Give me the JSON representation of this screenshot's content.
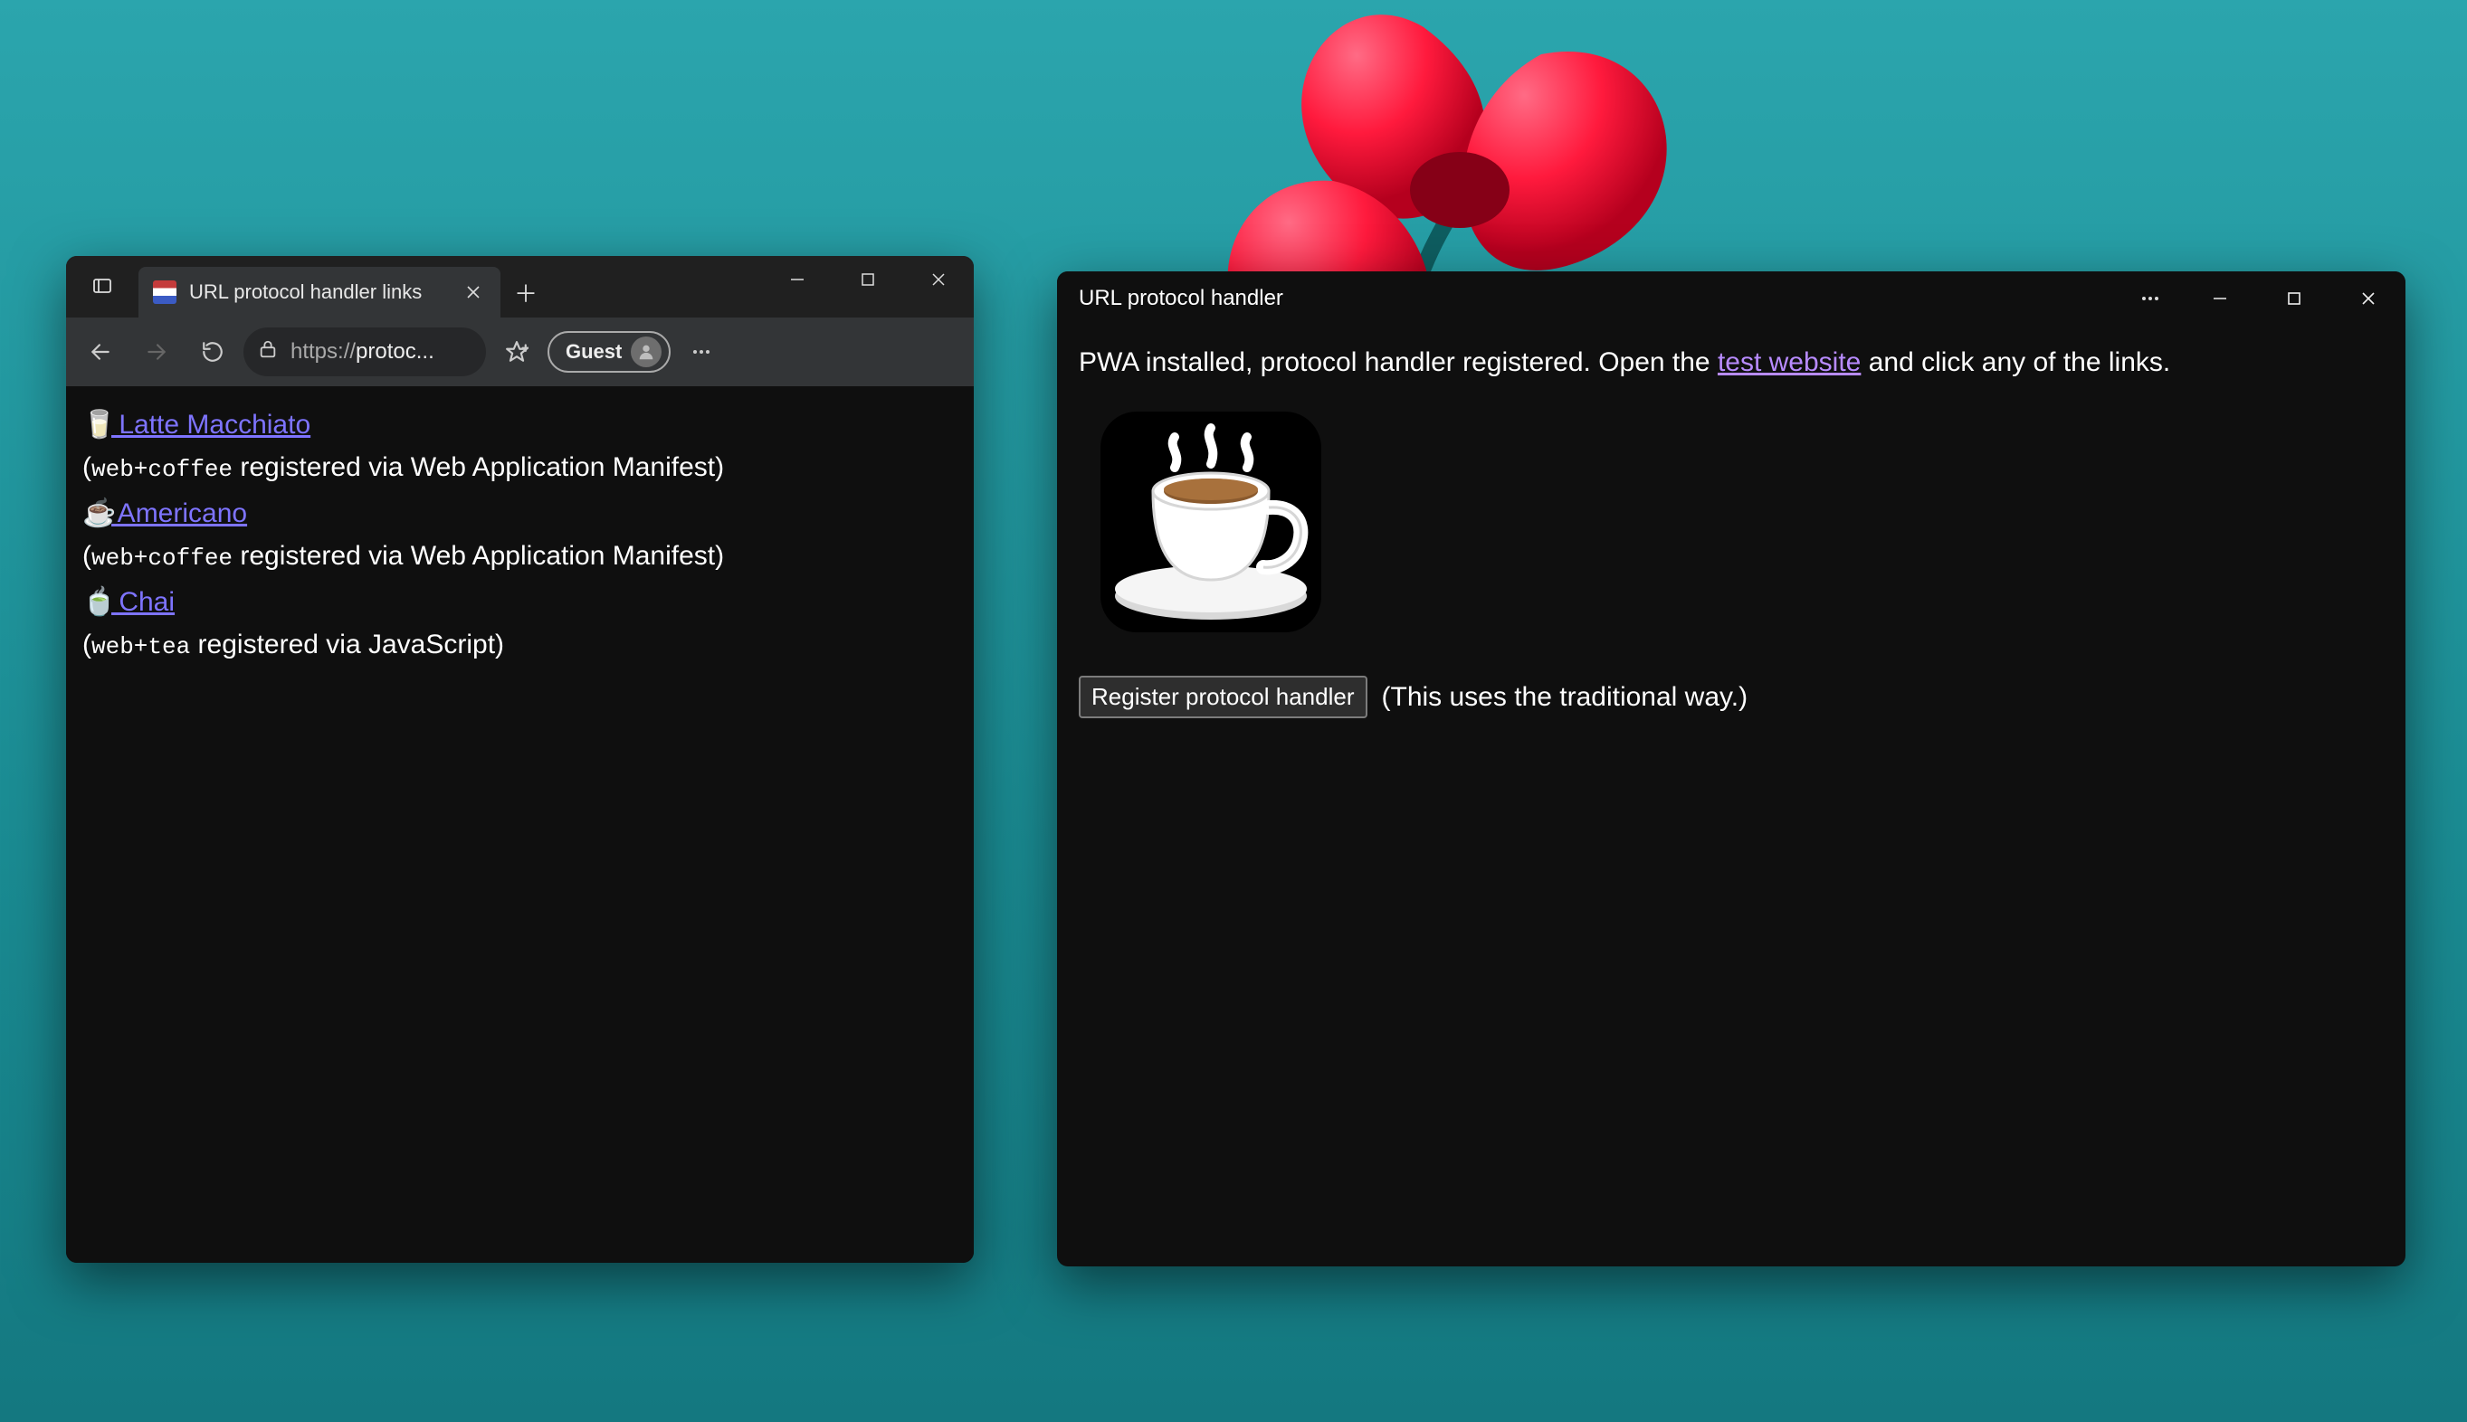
{
  "browser": {
    "tab_title": "URL protocol handler links",
    "url_display_prefix": "https://",
    "url_display_rest": "protoc...",
    "guest_label": "Guest",
    "links": [
      {
        "emoji": "🥛",
        "label": " Latte Macchiato",
        "proto": "web+coffee",
        "note": " registered via Web Application Manifest)"
      },
      {
        "emoji": "☕",
        "label": " Americano",
        "proto": "web+coffee",
        "note": " registered via Web Application Manifest)"
      },
      {
        "emoji": "🍵",
        "label": " Chai",
        "proto": "web+tea",
        "note": " registered via JavaScript)"
      }
    ]
  },
  "pwa": {
    "title": "URL protocol handler",
    "msg_before_link": "PWA installed, protocol handler registered. Open the ",
    "link_text": "test website",
    "msg_after_link": " and click any of the links.",
    "button_label": "Register protocol handler",
    "button_note": "(This uses the traditional way.)"
  }
}
